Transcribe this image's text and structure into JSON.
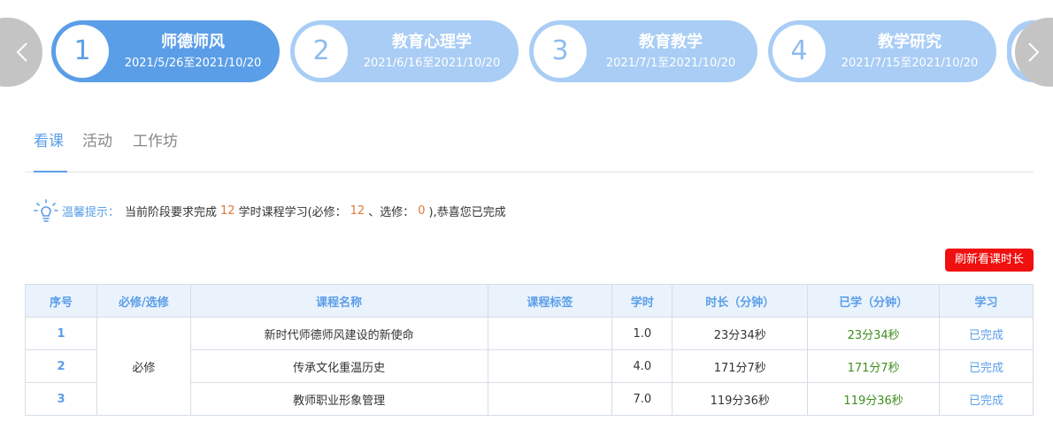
{
  "stages": [
    {
      "num": "1",
      "title": "师德师风",
      "date": "2021/5/26至2021/10/20",
      "active": true
    },
    {
      "num": "2",
      "title": "教育心理学",
      "date": "2021/6/16至2021/10/20",
      "active": false
    },
    {
      "num": "3",
      "title": "教育教学",
      "date": "2021/7/1至2021/10/20",
      "active": false
    },
    {
      "num": "4",
      "title": "教学研究",
      "date": "2021/7/15至2021/10/20",
      "active": false
    }
  ],
  "tabs": [
    "看课",
    "活动",
    "工作坊"
  ],
  "tip": {
    "label": "温馨提示：",
    "prefix": "当前阶段要求完成",
    "total": "12",
    "mid": "学时课程学习(必修：",
    "required": "12",
    "mid2": "、选修：",
    "elective": "0",
    "suffix": "),恭喜您已完成"
  },
  "refresh_label": "刷新看课时长",
  "table": {
    "headers": [
      "序号",
      "必修/选修",
      "课程名称",
      "课程标签",
      "学时",
      "时长（分钟）",
      "已学（分钟）",
      "学习"
    ],
    "group_type": "必修",
    "rows": [
      {
        "seq": "1",
        "name": "新时代师德师风建设的新使命",
        "tag": "",
        "hours": "1.0",
        "duration": "23分34秒",
        "learned": "23分34秒",
        "status": "已完成"
      },
      {
        "seq": "2",
        "name": "传承文化重温历史",
        "tag": "",
        "hours": "4.0",
        "duration": "171分7秒",
        "learned": "171分7秒",
        "status": "已完成"
      },
      {
        "seq": "3",
        "name": "教师职业形象管理",
        "tag": "",
        "hours": "7.0",
        "duration": "119分36秒",
        "learned": "119分36秒",
        "status": "已完成"
      }
    ]
  },
  "colors": {
    "accent": "#5b9ee8",
    "stage_inactive": "#a9cdf5",
    "highlight": "#e07b39",
    "learned": "#3e8e1f",
    "refresh": "#f01010"
  }
}
